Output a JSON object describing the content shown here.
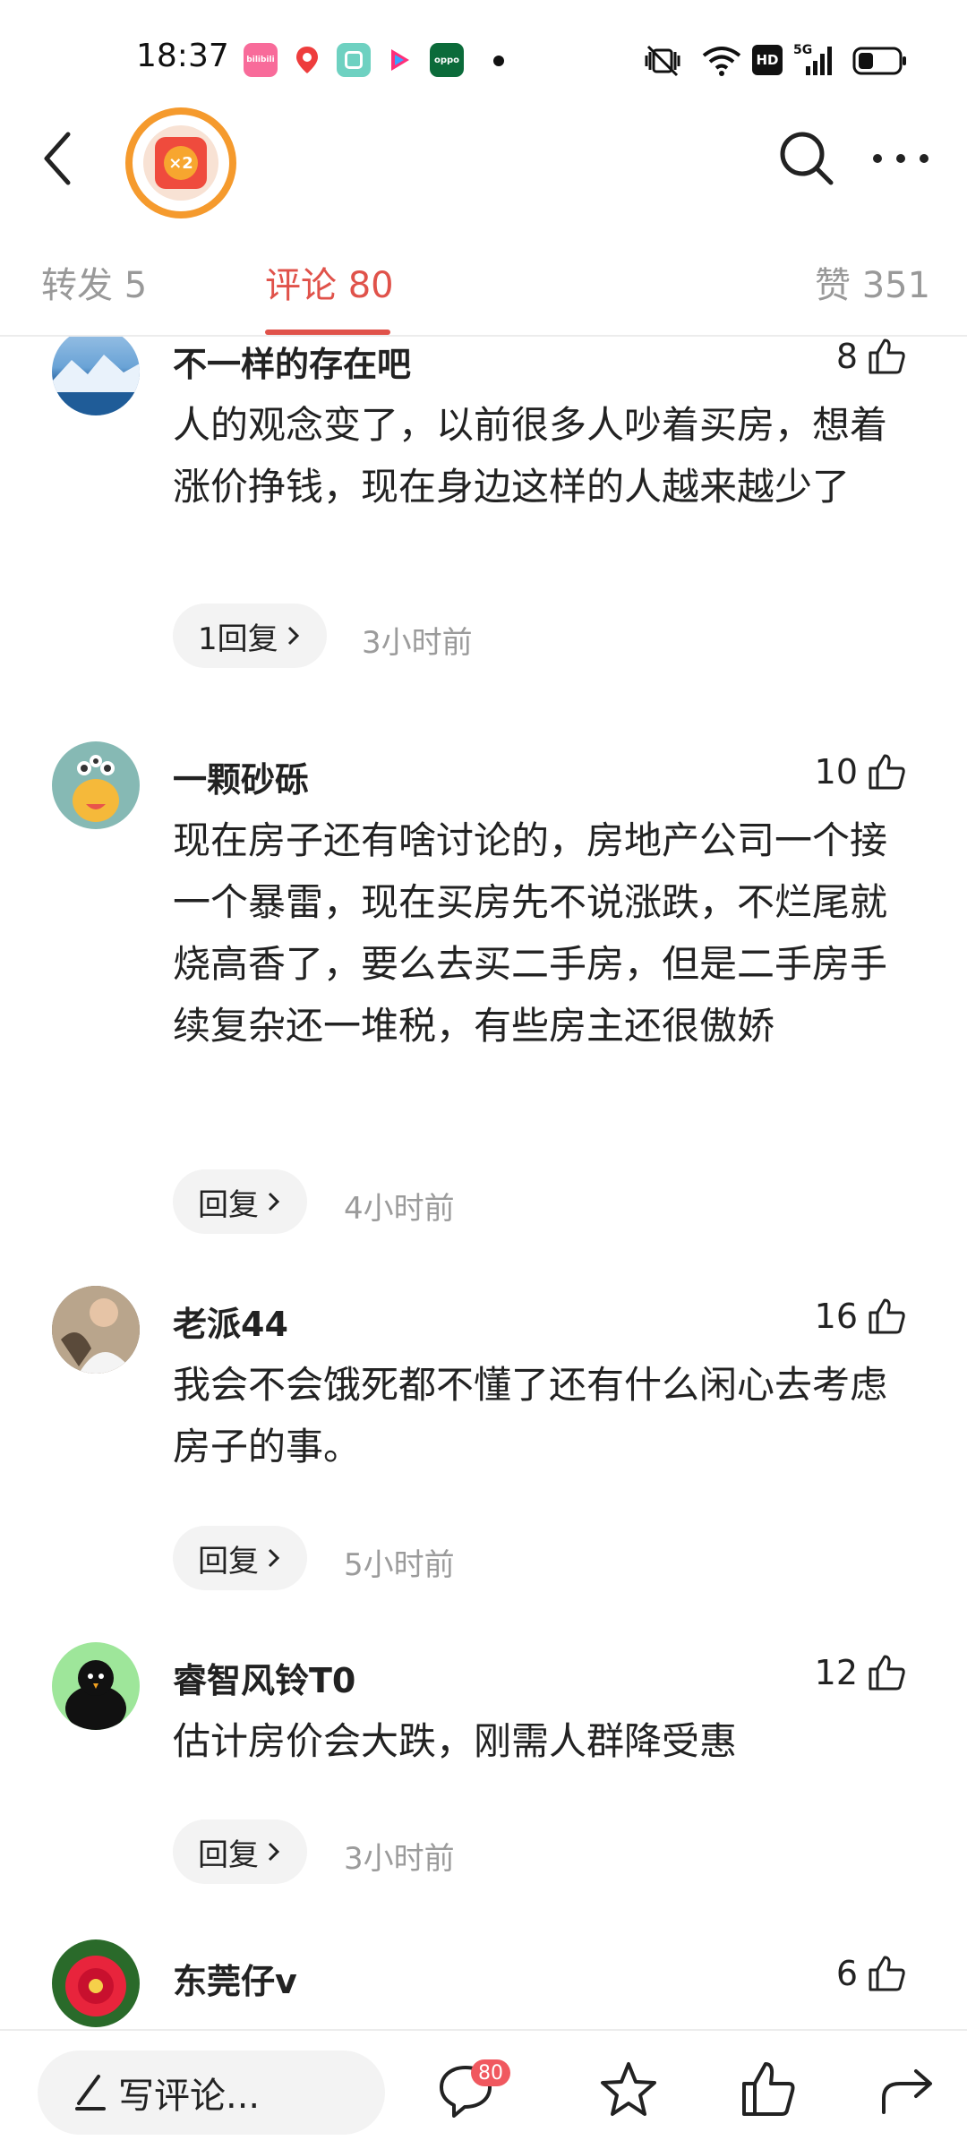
{
  "status_bar": {
    "time": "18:37",
    "app_icons": [
      {
        "name": "bilibili",
        "label": "bilibili",
        "color": "#f86b9a"
      },
      {
        "name": "map",
        "label": "",
        "color": "#ffffff"
      },
      {
        "name": "gallery",
        "label": "",
        "color": "#6ed1c1"
      },
      {
        "name": "video",
        "label": "",
        "color": "#ffffff"
      },
      {
        "name": "oppo",
        "label": "oppo",
        "color": "#0b6b3a"
      }
    ],
    "network": "5G",
    "hd": "HD"
  },
  "header": {
    "badge_label": "×2"
  },
  "tabs": [
    {
      "label": "转发 5",
      "active": false
    },
    {
      "label": "评论 80",
      "active": true
    },
    {
      "label": "赞 351",
      "active": false
    }
  ],
  "comments": [
    {
      "username": "不一样的存在吧",
      "likes": "8",
      "text": "人的观念变了，以前很多人吵着买房，想着涨价挣钱，现在身边这样的人越来越少了",
      "reply_label": "1回复",
      "time": "3小时前"
    },
    {
      "username": "一颗砂砾",
      "likes": "10",
      "text": "现在房子还有啥讨论的，房地产公司一个接一个暴雷，现在买房先不说涨跌，不烂尾就烧高香了，要么去买二手房，但是二手房手续复杂还一堆税，有些房主还很傲娇",
      "reply_label": "回复",
      "time": "4小时前"
    },
    {
      "username": "老派44",
      "likes": "16",
      "text": "我会不会饿死都不懂了还有什么闲心去考虑房子的事。",
      "reply_label": "回复",
      "time": "5小时前"
    },
    {
      "username": "睿智风铃T0",
      "likes": "12",
      "text": "估计房价会大跌，刚需人群降受惠",
      "reply_label": "回复",
      "time": "3小时前"
    },
    {
      "username": "东莞仔v",
      "likes": "6"
    }
  ],
  "bottom_bar": {
    "write_placeholder": "写评论...",
    "comment_count": "80"
  }
}
